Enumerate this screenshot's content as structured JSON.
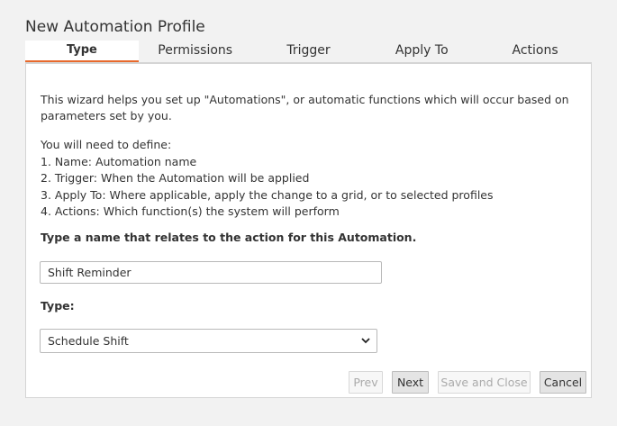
{
  "dialog": {
    "title": "New Automation Profile"
  },
  "tabs": [
    {
      "label": "Type",
      "active": true
    },
    {
      "label": "Permissions",
      "active": false
    },
    {
      "label": "Trigger",
      "active": false
    },
    {
      "label": "Apply To",
      "active": false
    },
    {
      "label": "Actions",
      "active": false
    }
  ],
  "content": {
    "intro": "This wizard helps you set up \"Automations\", or automatic functions which will occur based on parameters set by you.",
    "define_heading": "You will need to define:",
    "define_items": [
      "1. Name: Automation name",
      "2. Trigger: When the Automation will be applied",
      "3. Apply To: Where applicable, apply the change to a grid, or to selected profiles",
      "4. Actions: Which function(s) the system will perform"
    ],
    "name_label": "Type a name that relates to the action for this Automation.",
    "name_value": "Shift Reminder",
    "type_label": "Type:",
    "type_value": "Schedule Shift"
  },
  "buttons": {
    "prev": "Prev",
    "next": "Next",
    "save_close": "Save and Close",
    "cancel": "Cancel"
  },
  "colors": {
    "accent": "#e8692c",
    "background": "#f2f2f2",
    "panel": "#ffffff",
    "border": "#d5d5d5"
  }
}
